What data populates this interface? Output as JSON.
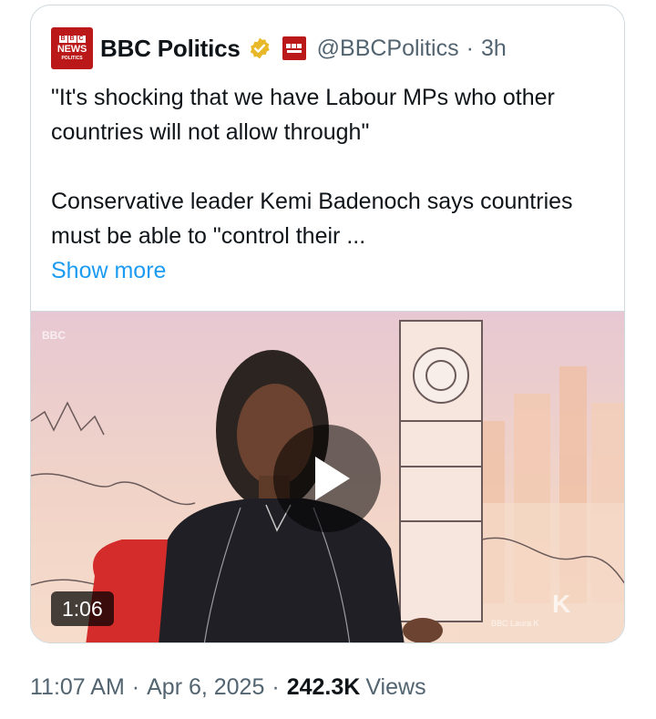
{
  "tweet": {
    "author_name": "BBC Politics",
    "handle": "@BBCPolitics",
    "separator": "·",
    "time_ago": "3h",
    "logo_text": {
      "bbc": [
        "B",
        "B",
        "C"
      ],
      "news": "NEWS",
      "politics": "POLITICS"
    },
    "text_line1": "\"It's shocking that we have Labour MPs who other countries will not allow through\"",
    "text_line2": "Conservative leader Kemi Badenoch says countries must be able to \"control their ...",
    "show_more": "Show more",
    "video": {
      "duration": "1:06",
      "watermark_logo": "BBC",
      "watermark_corner": "K",
      "watermark_credit": "BBC Laura K"
    }
  },
  "meta": {
    "time": "11:07 AM",
    "date": "Apr 6, 2025",
    "separator": "·",
    "views_count": "242.3K",
    "views_label": "Views"
  },
  "colors": {
    "brand_red": "#bb1919",
    "link_blue": "#1d9bf0",
    "verified_gold": "#e8b829",
    "muted_text": "#536471"
  },
  "icons": [
    "bbc-news-politics-logo",
    "verified-badge-icon",
    "bbc-news-mini-logo",
    "play-icon"
  ]
}
